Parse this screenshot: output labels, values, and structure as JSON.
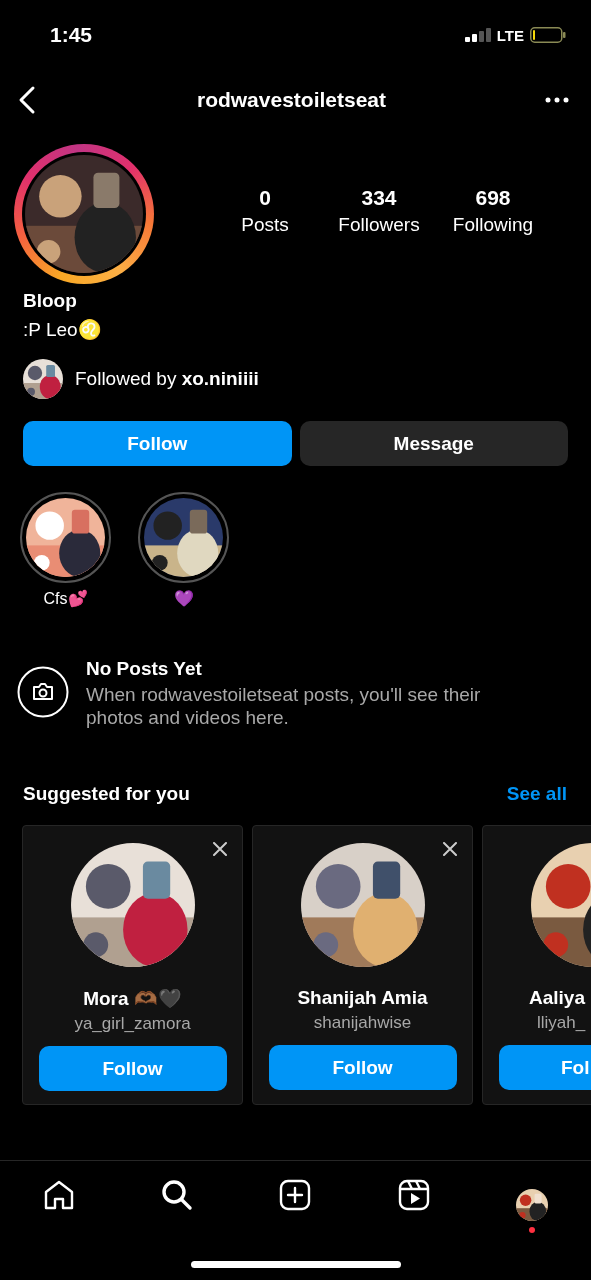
{
  "status_bar": {
    "time": "1:45",
    "network": "LTE"
  },
  "header": {
    "username": "rodwavestoiletseat"
  },
  "profile": {
    "stats": [
      {
        "value": "0",
        "label": "Posts"
      },
      {
        "value": "334",
        "label": "Followers"
      },
      {
        "value": "698",
        "label": "Following"
      }
    ],
    "name": "Bloop",
    "bio": ":P Leo♌",
    "followed_by": "Followed by **xo.niniiii**"
  },
  "actions": [
    {
      "label": "Follow",
      "kind": "primary"
    },
    {
      "label": "Message",
      "kind": "secondary"
    }
  ],
  "highlights": [
    {
      "label": "Cfs💕"
    },
    {
      "label": "💜"
    }
  ],
  "empty_state": {
    "title": "No Posts Yet",
    "text": "When rodwavestoiletseat posts, you'll see their photos and videos here."
  },
  "suggested": {
    "title": "Suggested for you",
    "link": "See all",
    "cards": [
      {
        "name": "Mora 🫶🏾🖤",
        "username": "ya_girl_zamora",
        "button": "Follow",
        "dismissible": true
      },
      {
        "name": "Shanijah Amia",
        "username": "shanijahwise",
        "button": "Follow",
        "dismissible": true
      },
      {
        "name": "Aaliya",
        "username": "lliyah_",
        "button": "Fol"
      }
    ]
  },
  "nav": [
    {
      "kind": "home",
      "selected": false
    },
    {
      "kind": "search",
      "selected": true
    },
    {
      "kind": "create",
      "selected": false
    },
    {
      "kind": "reels",
      "selected": false
    },
    {
      "kind": "profile",
      "selected": false,
      "has_notification": true
    }
  ]
}
